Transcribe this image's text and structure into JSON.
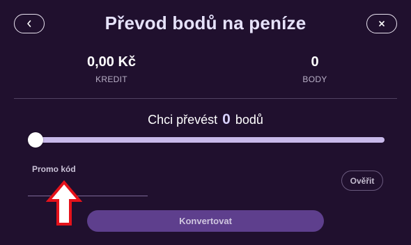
{
  "header": {
    "title": "Převod bodů na peníze",
    "back_icon": "chevron-left-icon",
    "close_icon": "close-icon"
  },
  "stats": {
    "credit_value": "0,00 Kč",
    "credit_label": "KREDIT",
    "points_value": "0",
    "points_label": "BODY"
  },
  "converter": {
    "question_prefix": "Chci převést",
    "question_amount": "0",
    "question_suffix": "bodů",
    "slider_value": 0
  },
  "promo": {
    "label": "Promo kód",
    "value": "",
    "placeholder": "",
    "verify_label": "Ověřit"
  },
  "actions": {
    "convert_label": "Konvertovat"
  },
  "annotation": {
    "arrow_icon": "up-arrow-icon",
    "arrow_color": "#e5121b"
  },
  "colors": {
    "background": "#20102e",
    "accent": "#5e3f8d",
    "slider_track": "#c8b9ea"
  }
}
